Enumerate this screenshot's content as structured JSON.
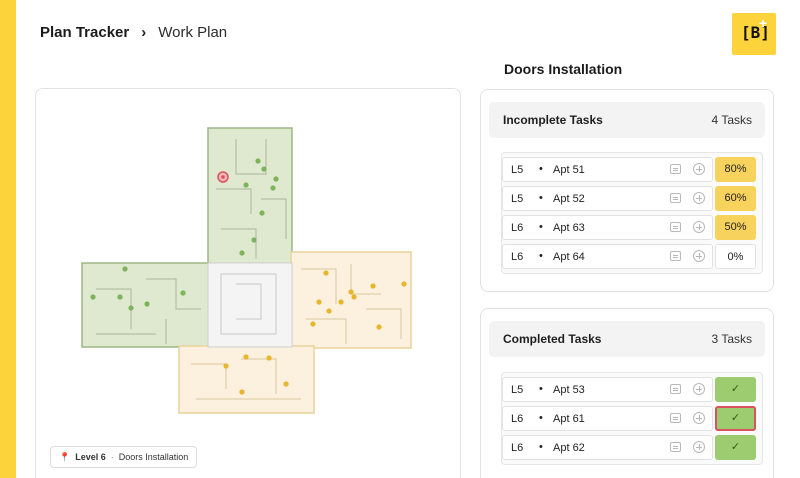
{
  "breadcrumb": {
    "root": "Plan Tracker",
    "separator": "›",
    "current": "Work Plan"
  },
  "logo": {
    "glyph": "[B]",
    "plus": "+"
  },
  "plan": {
    "level": "Level 6",
    "separator": "·",
    "activity": "Doors Installation",
    "pin_icon": "location-pin-icon"
  },
  "section": {
    "title": "Doors Installation"
  },
  "incomplete": {
    "label": "Incomplete Tasks",
    "count": "4 Tasks",
    "rows": [
      {
        "level": "L5",
        "apt": "Apt 51",
        "status": "80%"
      },
      {
        "level": "L5",
        "apt": "Apt 52",
        "status": "60%"
      },
      {
        "level": "L6",
        "apt": "Apt 63",
        "status": "50%"
      },
      {
        "level": "L6",
        "apt": "Apt 64",
        "status": "0%"
      }
    ]
  },
  "completed": {
    "label": "Completed Tasks",
    "count": "3 Tasks",
    "rows": [
      {
        "level": "L5",
        "apt": "Apt 53",
        "status": "✓"
      },
      {
        "level": "L6",
        "apt": "Apt 61",
        "status": "✓"
      },
      {
        "level": "L6",
        "apt": "Apt 62",
        "status": "✓"
      }
    ]
  },
  "row_bullet": "•",
  "colors": {
    "accent": "#fdd33b",
    "done": "#9ccc6f",
    "progress": "#f7d25c",
    "selected": "#d9535f"
  }
}
